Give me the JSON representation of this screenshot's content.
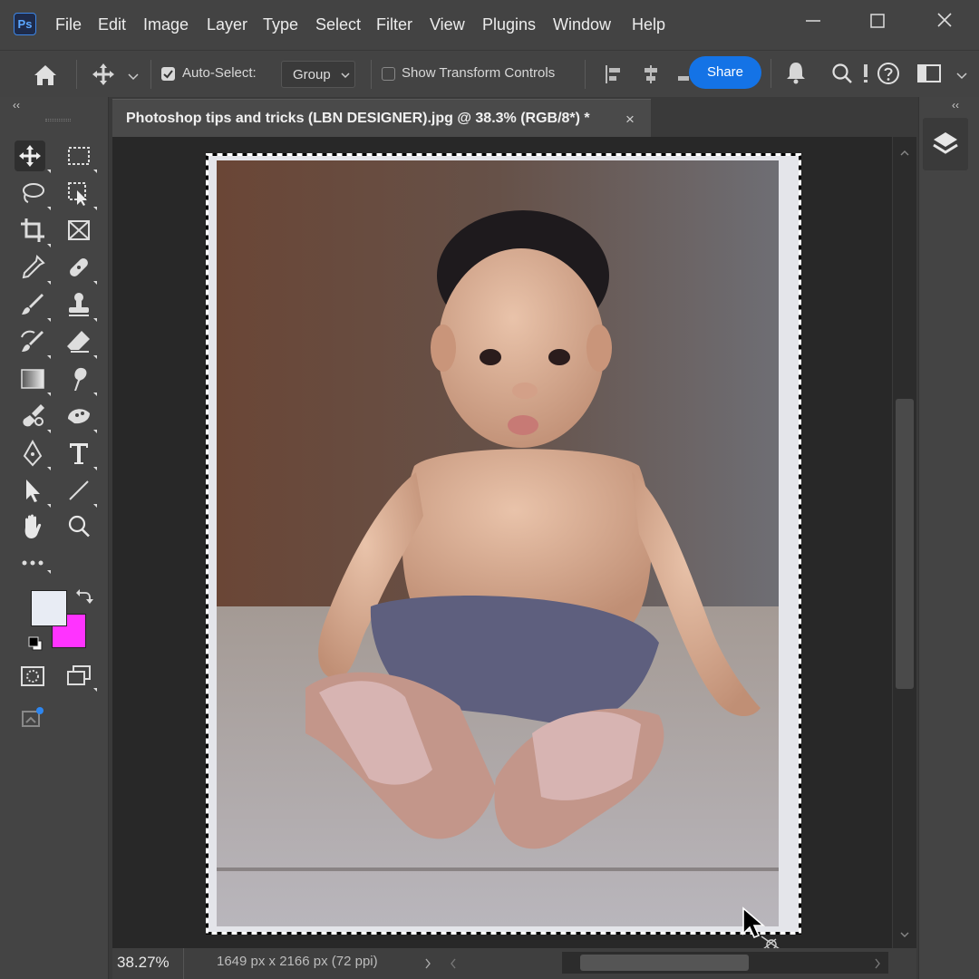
{
  "app": {
    "logo_text": "Ps",
    "menu": [
      "File",
      "Edit",
      "Image",
      "Layer",
      "Type",
      "Select",
      "Filter",
      "View",
      "Plugins",
      "Window",
      "Help"
    ]
  },
  "options_bar": {
    "auto_select_label": "Auto-Select:",
    "auto_select_checked": true,
    "group_value": "Group",
    "show_transform_label": "Show Transform Controls",
    "show_transform_checked": false,
    "share_label": "Share",
    "accent_color": "#1473e6"
  },
  "document": {
    "tab_title": "Photoshop tips and tricks (LBN DESIGNER).jpg @ 38.3% (RGB/8*) *",
    "close_glyph": "×",
    "photo_description": "vintage photo of a seated baby in dark shorts and white socks"
  },
  "status_bar": {
    "zoom": "38.27%",
    "doc_info": "1649 px x 2166 px (72 ppi)"
  },
  "colors": {
    "foreground": "#e8ecf4",
    "background": "#ff33ff"
  },
  "panels": {
    "collapse_glyph": "‹‹"
  }
}
